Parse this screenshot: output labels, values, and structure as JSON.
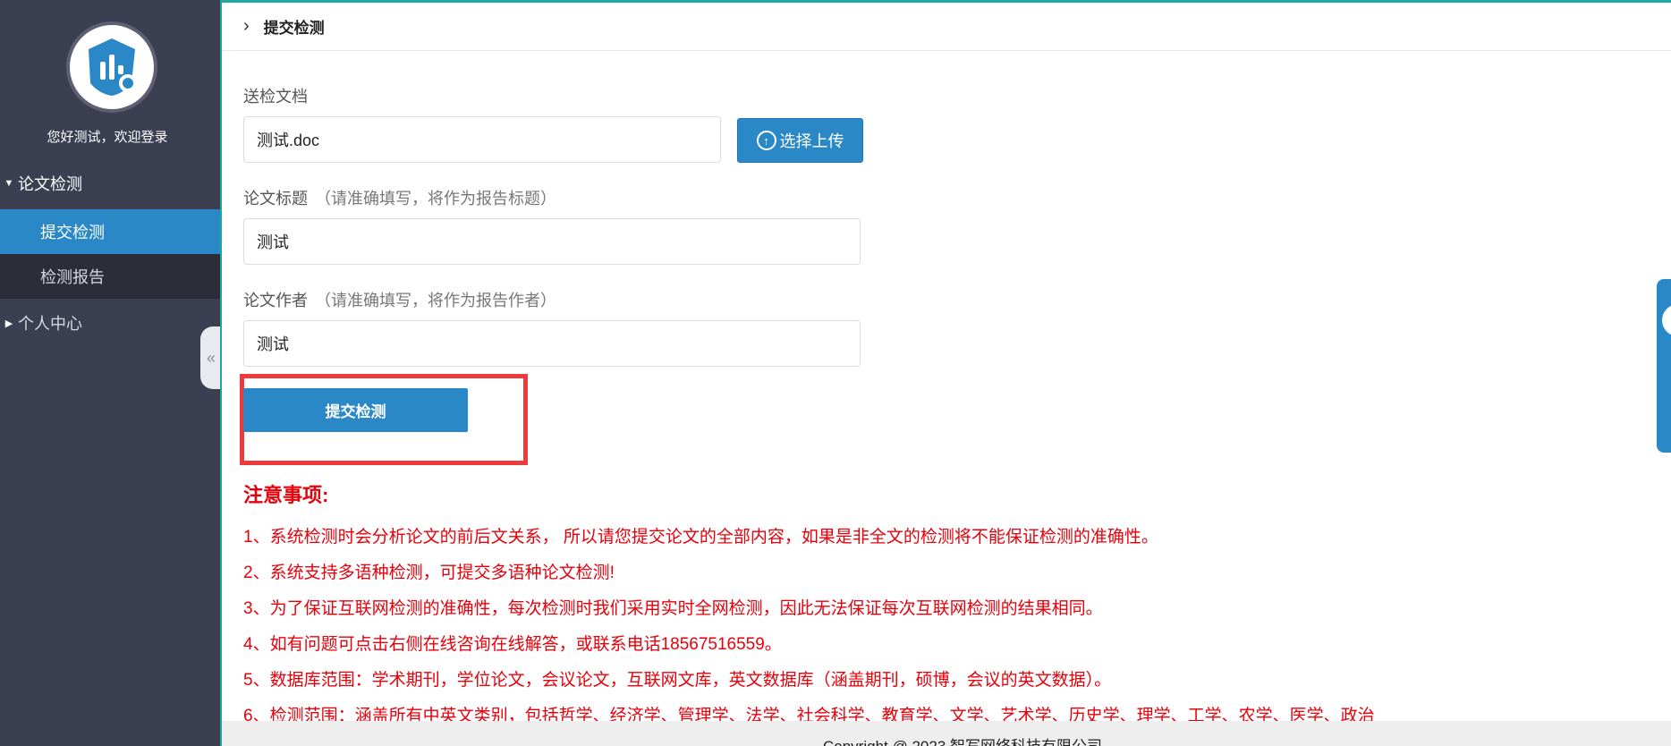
{
  "sidebar": {
    "welcome": "您好测试，欢迎登录",
    "groups": [
      {
        "label": "论文检测",
        "expanded": true
      },
      {
        "label": "个人中心",
        "expanded": false
      }
    ],
    "items": [
      {
        "label": "提交检测",
        "active": true
      },
      {
        "label": "检测报告",
        "active": false
      }
    ],
    "collapse_icon": "«"
  },
  "breadcrumb": {
    "chevron": "›",
    "title": "提交检测"
  },
  "form": {
    "doc_label": "送检文档",
    "doc_value": "测试.doc",
    "upload_label": "选择上传",
    "title_label": "论文标题",
    "title_hint": "（请准确填写，将作为报告标题）",
    "title_value": "测试",
    "author_label": "论文作者",
    "author_hint": "（请准确填写，将作为报告作者）",
    "author_value": "测试",
    "submit_label": "提交检测"
  },
  "notes": {
    "title": "注意事项:",
    "items": [
      "1、系统检测时会分析论文的前后文关系， 所以请您提交论文的全部内容，如果是非全文的检测将不能保证检测的准确性。",
      "2、系统支持多语种检测，可提交多语种论文检测!",
      "3、为了保证互联网检测的准确性，每次检测时我们采用实时全网检测，因此无法保证每次互联网检测的结果相同。",
      "4、如有问题可点击右侧在线咨询在线解答，或联系电话18567516559。",
      "5、数据库范围：学术期刊，学位论文，会议论文，互联网文库，英文数据库（涵盖期刊，硕博，会议的英文数据）。",
      "6、检测范围：涵盖所有中英文类别，包括哲学、经济学、管理学、法学、社会科学、教育学、文学、艺术学、历史学、理学、工学、农学、医学、政治"
    ]
  },
  "footer": {
    "text": "Copyright @ 2023 智写网络科技有限公司"
  },
  "colors": {
    "sidebar_bg": "#3c3f51",
    "accent": "#2a88c6",
    "alert_red": "#e8000b",
    "highlight_red": "#ee3a3a",
    "teal_line": "#1fa7a0"
  },
  "icons": [
    "logo-icon",
    "triangle-down-icon",
    "triangle-right-icon",
    "collapse-icon",
    "chevron-right-icon",
    "upload-icon",
    "chat-icon"
  ]
}
